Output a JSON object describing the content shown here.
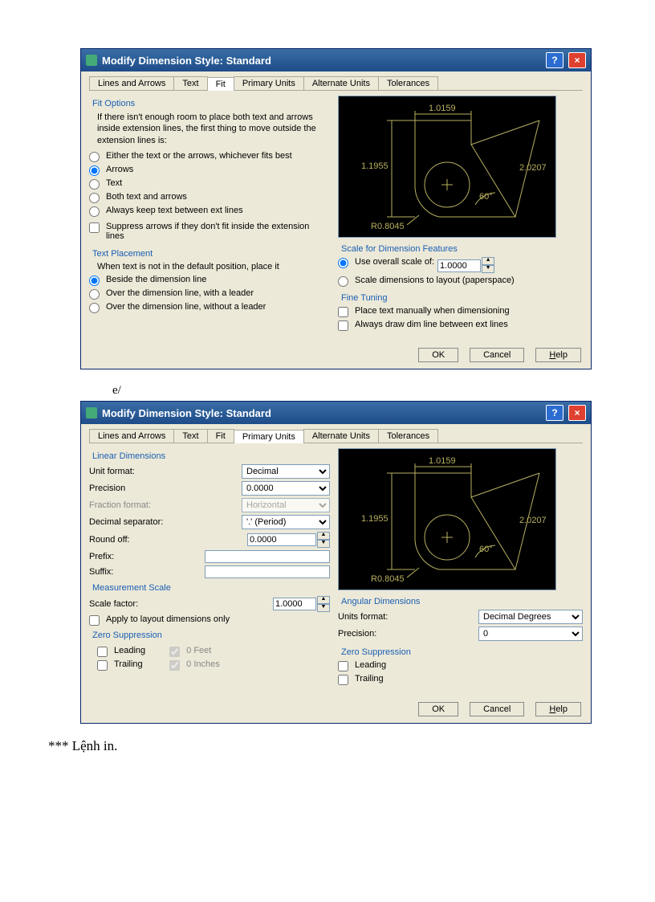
{
  "title": "Modify Dimension Style: Standard",
  "tabs": [
    "Lines and Arrows",
    "Text",
    "Fit",
    "Primary Units",
    "Alternate Units",
    "Tolerances"
  ],
  "fit": {
    "options_title": "Fit Options",
    "options_desc": "If there isn't enough room to place both text and arrows inside extension lines, the first thing to move outside the extension lines is:",
    "r1": "Either the text or the arrows, whichever fits best",
    "r2": "Arrows",
    "r3": "Text",
    "r4": "Both text and arrows",
    "r5": "Always keep text between ext lines",
    "chk1": "Suppress arrows if they don't fit inside the extension lines",
    "placement_title": "Text Placement",
    "placement_desc": "When text is not in the default position, place it",
    "p1": "Beside the dimension line",
    "p2": "Over the dimension line, with a leader",
    "p3": "Over the dimension line, without a leader",
    "scale_title": "Scale for Dimension Features",
    "s1": "Use overall scale of:",
    "s1v": "1.0000",
    "s2": "Scale dimensions to layout (paperspace)",
    "tune_title": "Fine Tuning",
    "t1": "Place text manually when dimensioning",
    "t2": "Always draw dim line between ext lines"
  },
  "pu": {
    "ld_title": "Linear Dimensions",
    "uf": "Unit format:",
    "uf_v": "Decimal",
    "pr": "Precision",
    "pr_v": "0.0000",
    "ff": "Fraction format:",
    "ff_v": "Horizontal",
    "ds": "Decimal separator:",
    "ds_v": "'.' (Period)",
    "ro": "Round off:",
    "ro_v": "0.0000",
    "pf": "Prefix:",
    "pf_v": "",
    "sf": "Suffix:",
    "sf_v": "",
    "ms_title": "Measurement Scale",
    "scf": "Scale factor:",
    "scf_v": "1.0000",
    "alo": "Apply to layout dimensions only",
    "zs_title": "Zero Suppression",
    "zl": "Leading",
    "zt": "Trailing",
    "zf": "0 Feet",
    "zi": "0 Inches",
    "ad_title": "Angular Dimensions",
    "au": "Units format:",
    "au_v": "Decimal Degrees",
    "ap": "Precision:",
    "ap_v": "0"
  },
  "preview": {
    "d1": "1.0159",
    "d2": "1.1955",
    "d3": "2.0207",
    "d4": "60°",
    "d5": "R0.8045"
  },
  "btn_ok": "OK",
  "btn_cancel": "Cancel",
  "btn_help": "Help",
  "sep": "e/",
  "footer": "*** Lệnh in."
}
